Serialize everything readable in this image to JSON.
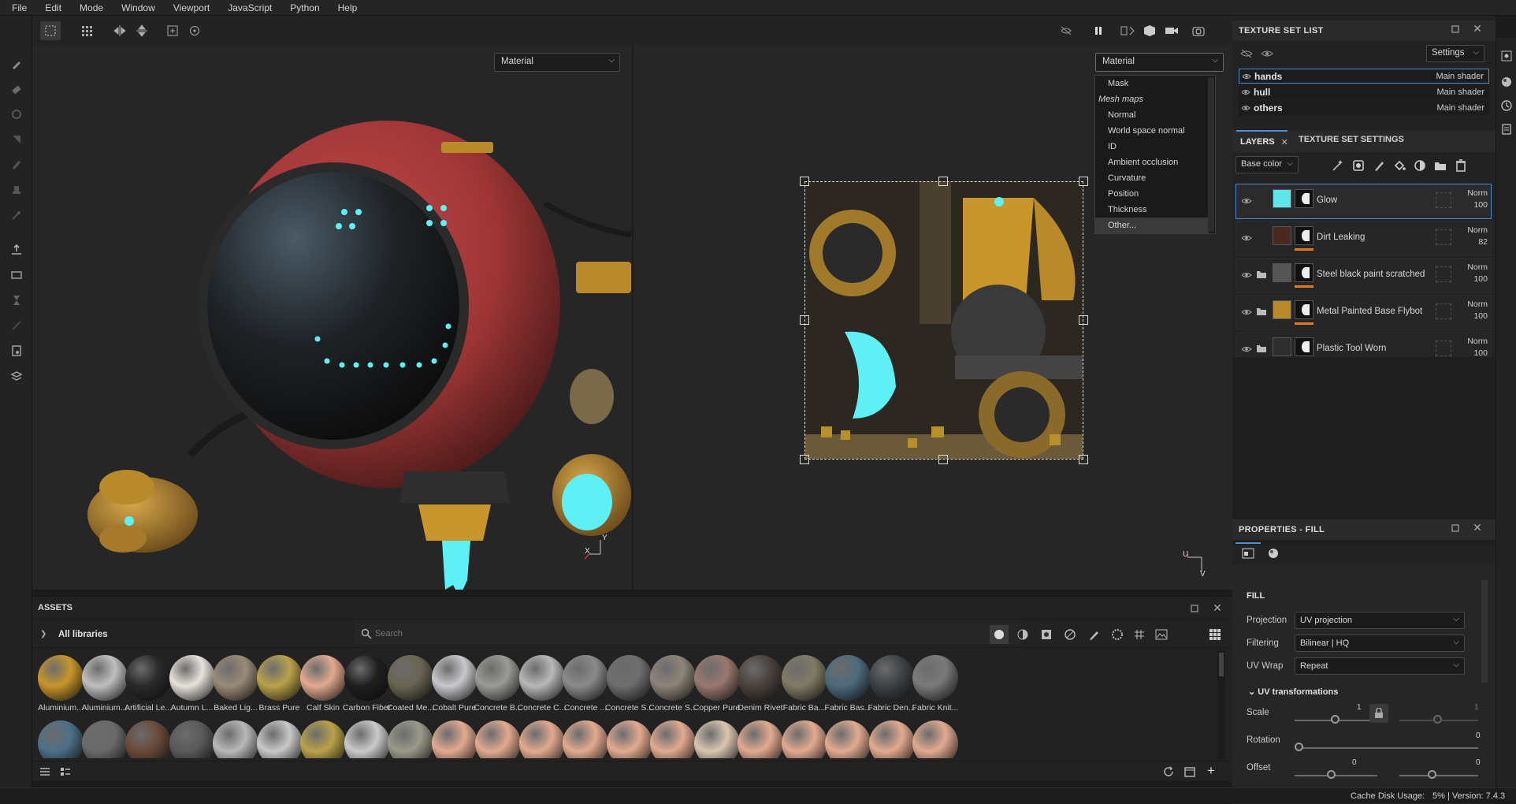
{
  "menu": [
    "File",
    "Edit",
    "Mode",
    "Window",
    "Viewport",
    "JavaScript",
    "Python",
    "Help"
  ],
  "viewport": {
    "left_mode": "Material",
    "right_mode": "Material",
    "axis_left": {
      "x": "X",
      "y": "Y"
    },
    "axis_right": {
      "u": "U",
      "v": "V"
    },
    "dropdown_options": [
      {
        "label": "Mask",
        "italic": false
      },
      {
        "label": "Mesh maps",
        "italic": true
      },
      {
        "label": "Normal",
        "italic": false
      },
      {
        "label": "World space normal",
        "italic": false
      },
      {
        "label": "ID",
        "italic": false
      },
      {
        "label": "Ambient occlusion",
        "italic": false
      },
      {
        "label": "Curvature",
        "italic": false
      },
      {
        "label": "Position",
        "italic": false
      },
      {
        "label": "Thickness",
        "italic": false
      },
      {
        "label": "Other...",
        "italic": false,
        "highlighted": true
      }
    ]
  },
  "texture_set_list": {
    "title": "TEXTURE SET LIST",
    "settings_label": "Settings",
    "sets": [
      {
        "name": "hands",
        "shader": "Main shader",
        "selected": true
      },
      {
        "name": "hull",
        "shader": "Main shader",
        "selected": false
      },
      {
        "name": "others",
        "shader": "Main shader",
        "selected": false
      }
    ]
  },
  "layers_panel": {
    "tab_layers": "LAYERS",
    "tab_settings": "TEXTURE SET SETTINGS",
    "channel": "Base color",
    "layers": [
      {
        "name": "Glow",
        "blend": "Norm",
        "opacity": "100",
        "selected": true,
        "folder": false,
        "color": "#5fe6ec"
      },
      {
        "name": "Dirt Leaking",
        "blend": "Norm",
        "opacity": "82",
        "selected": false,
        "folder": false,
        "color": "#4a2a20"
      },
      {
        "name": "Steel black paint scratched",
        "blend": "Norm",
        "opacity": "100",
        "selected": false,
        "folder": true,
        "color": "#555555"
      },
      {
        "name": "Metal Painted Base Flybot",
        "blend": "Norm",
        "opacity": "100",
        "selected": false,
        "folder": true,
        "color": "#b88a2a"
      },
      {
        "name": "Plastic Tool Worn",
        "blend": "Norm",
        "opacity": "100",
        "selected": false,
        "folder": true,
        "color": "#2e2e2e"
      }
    ]
  },
  "properties": {
    "title": "PROPERTIES - FILL",
    "section": "FILL",
    "projection_label": "Projection",
    "projection_value": "UV projection",
    "filtering_label": "Filtering",
    "filtering_value": "Bilinear | HQ",
    "uvwrap_label": "UV Wrap",
    "uvwrap_value": "Repeat",
    "uv_transformations": "UV transformations",
    "scale_label": "Scale",
    "scale_value": "1",
    "scale_value2": "1",
    "rotation_label": "Rotation",
    "rotation_value": "0",
    "offset_label": "Offset",
    "offset_value_1": "0",
    "offset_value_2": "0"
  },
  "assets": {
    "title": "ASSETS",
    "breadcrumb": "All libraries",
    "search_placeholder": "Search",
    "row1": [
      {
        "label": "Aluminium...",
        "color": "#c8962a"
      },
      {
        "label": "Aluminium...",
        "color": "#bfbfbf"
      },
      {
        "label": "Artificial Le...",
        "color": "#2a2a2a"
      },
      {
        "label": "Autumn L...",
        "color": "#e8e2dc"
      },
      {
        "label": "Baked Lig...",
        "color": "#9a8a78"
      },
      {
        "label": "Brass Pure",
        "color": "#b9a24a"
      },
      {
        "label": "Calf Skin",
        "color": "#e2aa90"
      },
      {
        "label": "Carbon Fiber",
        "color": "#1f1f1f"
      },
      {
        "label": "Coated Me...",
        "color": "#6a6552"
      },
      {
        "label": "Cobalt Pure",
        "color": "#c8c8cc"
      },
      {
        "label": "Concrete B...",
        "color": "#9a9a96"
      },
      {
        "label": "Concrete C...",
        "color": "#b8b8b8"
      },
      {
        "label": "Concrete ...",
        "color": "#8a8a8a"
      },
      {
        "label": "Concrete S...",
        "color": "#6e6e6e"
      },
      {
        "label": "Concrete S...",
        "color": "#8e8478"
      },
      {
        "label": "Copper Pure",
        "color": "#9a7870"
      },
      {
        "label": "Denim Rivet",
        "color": "#4a423c"
      },
      {
        "label": "Fabric Ba...",
        "color": "#807a66"
      },
      {
        "label": "Fabric Bas...",
        "color": "#4e6a7c"
      },
      {
        "label": "Fabric Den...",
        "color": "#3e4246"
      },
      {
        "label": "Fabric Knit...",
        "color": "#7a7a7a"
      }
    ],
    "row2_colors": [
      "#4d6f88",
      "#6a6a6a",
      "#6a4a3a",
      "#5a5a5a",
      "#b8b8b8",
      "#c8c8c8",
      "#b9a24a",
      "#cacaca",
      "#9a9a8a",
      "#e2aa90",
      "#e2aa90",
      "#e2aa90",
      "#e2aa90",
      "#e2aa90",
      "#e2aa90",
      "#d9c6b0",
      "#e2aa90",
      "#e2aa90",
      "#e2aa90",
      "#e2aa90",
      "#e2aa90"
    ]
  },
  "status": {
    "cache": "Cache Disk Usage:",
    "usage": "5% | Version: 7.4.3"
  }
}
